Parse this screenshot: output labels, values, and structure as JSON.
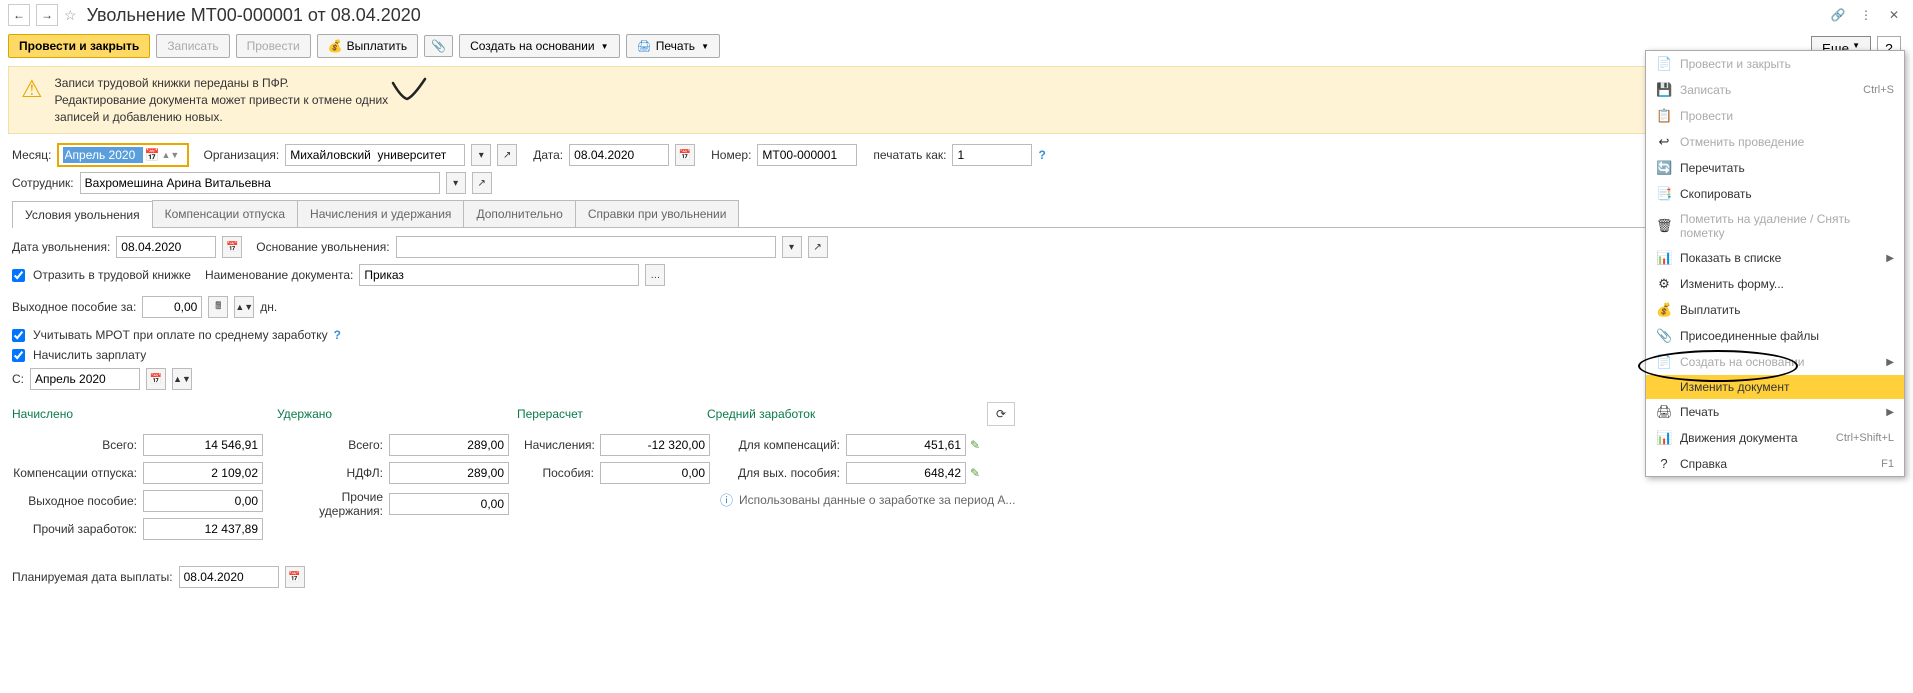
{
  "title": "Увольнение МТ00-000001 от 08.04.2020",
  "toolbar": {
    "post_close": "Провести и закрыть",
    "save": "Записать",
    "post": "Провести",
    "pay": "Выплатить",
    "create_based": "Создать на основании",
    "print": "Печать",
    "more": "Еще"
  },
  "banner": {
    "line1": "Записи трудовой книжки переданы в ПФР.",
    "line2": "Редактирование документа может привести к отмене одних",
    "line3": "записей и добавлению новых."
  },
  "labels": {
    "month": "Месяц:",
    "org": "Организация:",
    "date": "Дата:",
    "number": "Номер:",
    "print_as": "печатать как:",
    "employee": "Сотрудник:",
    "dismiss_date": "Дата увольнения:",
    "basis": "Основание увольнения:",
    "doc_name": "Наименование документа:",
    "severance": "Выходное пособие за:",
    "days": "дн.",
    "from": "С:",
    "reflect": "Отразить в трудовой книжке",
    "use_mrot": "Учитывать МРОТ при оплате по среднему заработку",
    "accrue_salary": "Начислить зарплату",
    "planned_pay_date": "Планируемая дата выплаты:"
  },
  "values": {
    "month": "Апрель 2020",
    "org": "Михайловский  университет",
    "date": "08.04.2020",
    "number": "МТ00-000001",
    "print_as": "1",
    "employee": "Вахромешина Арина Витальевна",
    "dismiss_date": "08.04.2020",
    "doc_name": "Приказ",
    "severance_amount": "0,00",
    "from_month": "Апрель 2020",
    "planned_date": "08.04.2020"
  },
  "tabs": [
    {
      "label": "Условия увольнения",
      "active": true
    },
    {
      "label": "Компенсации отпуска",
      "active": false
    },
    {
      "label": "Начисления и удержания",
      "active": false
    },
    {
      "label": "Дополнительно",
      "active": false
    },
    {
      "label": "Справки при увольнении",
      "active": false
    }
  ],
  "totals_headers": {
    "accrued": "Начислено",
    "withheld": "Удержано",
    "recalc": "Перерасчет",
    "avg_earn": "Средний заработок"
  },
  "totals": {
    "total_label": "Всего:",
    "total_accrued": "14 546,91",
    "comp_label": "Компенсации отпуска:",
    "comp_value": "2 109,02",
    "sev_label": "Выходное пособие:",
    "sev_value": "0,00",
    "other_label": "Прочий заработок:",
    "other_value": "12 437,89",
    "withheld_total_label": "Всего:",
    "withheld_total": "289,00",
    "ndfl_label": "НДФЛ:",
    "ndfl_value": "289,00",
    "other_with_label": "Прочие удержания:",
    "other_with_value": "0,00",
    "accruals_label": "Начисления:",
    "accruals_value": "-12 320,00",
    "benefits_label": "Пособия:",
    "benefits_value": "0,00",
    "for_comp_label": "Для компенсаций:",
    "for_comp_value": "451,61",
    "for_sev_label": "Для вых. пособия:",
    "for_sev_value": "648,42",
    "info_text": "Использованы данные о заработке за период А..."
  },
  "menu": [
    {
      "icon": "📄",
      "label": "Провести и закрыть",
      "disabled": true
    },
    {
      "icon": "💾",
      "label": "Записать",
      "shortcut": "Ctrl+S",
      "disabled": true
    },
    {
      "icon": "📋",
      "label": "Провести",
      "disabled": true
    },
    {
      "icon": "↩",
      "label": "Отменить проведение",
      "disabled": true
    },
    {
      "icon": "🔄",
      "label": "Перечитать",
      "color": "#0a7a4a"
    },
    {
      "icon": "📑",
      "label": "Скопировать"
    },
    {
      "icon": "🗑",
      "label": "Пометить на удаление / Снять пометку",
      "disabled": true
    },
    {
      "icon": "📊",
      "label": "Показать в списке",
      "arrow": true
    },
    {
      "icon": "⚙",
      "label": "Изменить форму..."
    },
    {
      "icon": "💰",
      "label": "Выплатить"
    },
    {
      "icon": "📎",
      "label": "Присоединенные файлы"
    },
    {
      "icon": "📄",
      "label": "Создать на основании",
      "arrow": true,
      "disabled": true
    },
    {
      "icon": "",
      "label": "Изменить документ",
      "highlighted": true
    },
    {
      "icon": "🖨",
      "label": "Печать",
      "arrow": true
    },
    {
      "icon": "📊",
      "label": "Движения документа",
      "shortcut": "Ctrl+Shift+L"
    },
    {
      "icon": "?",
      "label": "Справка",
      "shortcut": "F1"
    }
  ]
}
